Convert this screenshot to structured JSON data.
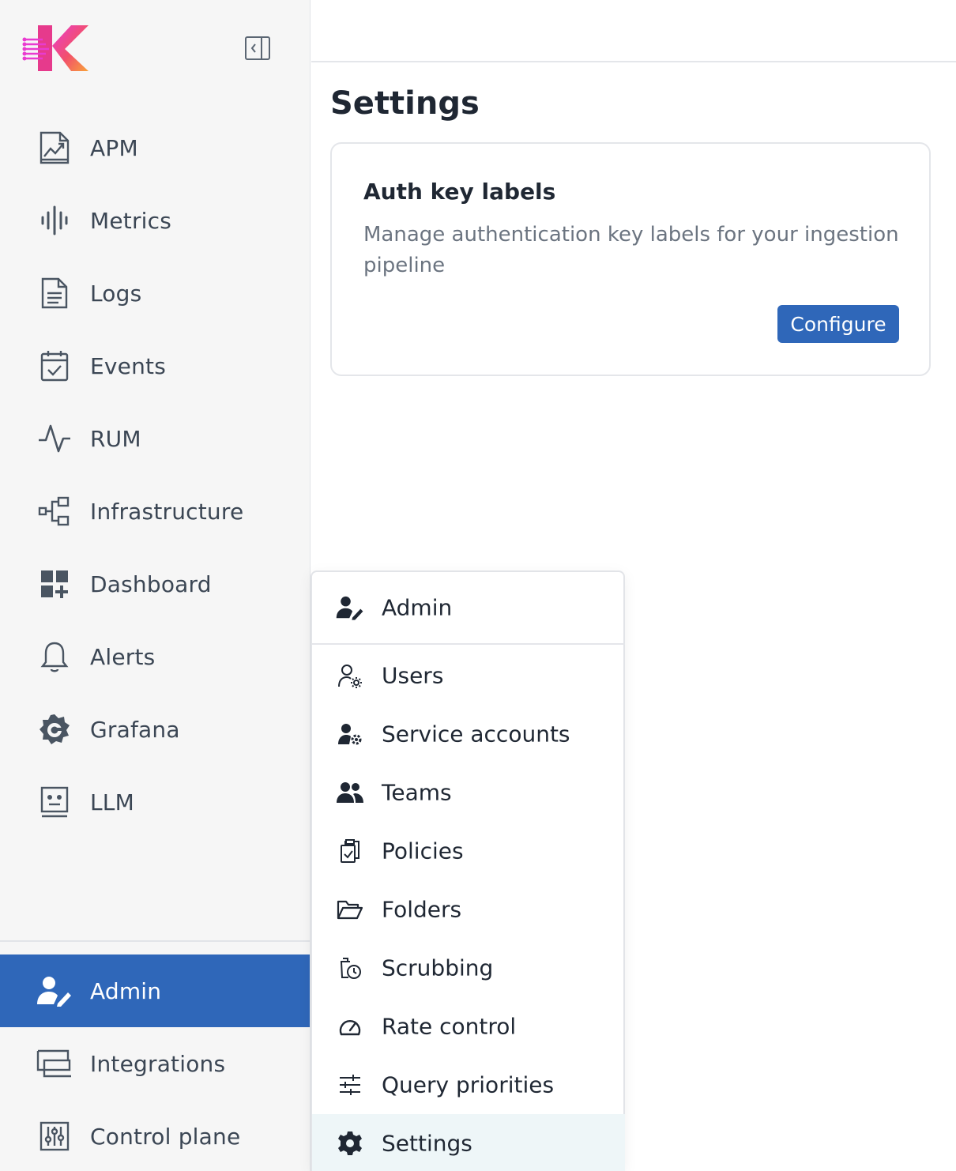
{
  "sidebar": {
    "logo_icon": "k-logo",
    "collapse_icon": "collapse-sidebar-icon",
    "items": [
      {
        "label": "APM",
        "icon": "apm-icon"
      },
      {
        "label": "Metrics",
        "icon": "metrics-icon"
      },
      {
        "label": "Logs",
        "icon": "logs-icon"
      },
      {
        "label": "Events",
        "icon": "events-icon"
      },
      {
        "label": "RUM",
        "icon": "rum-icon"
      },
      {
        "label": "Infrastructure",
        "icon": "infrastructure-icon"
      },
      {
        "label": "Dashboard",
        "icon": "dashboard-icon"
      },
      {
        "label": "Alerts",
        "icon": "bell-icon"
      },
      {
        "label": "Grafana",
        "icon": "grafana-icon"
      },
      {
        "label": "LLM",
        "icon": "llm-icon"
      }
    ],
    "bottom_items": [
      {
        "label": "Admin",
        "icon": "admin-icon",
        "active": true
      },
      {
        "label": "Integrations",
        "icon": "integrations-icon"
      },
      {
        "label": "Control plane",
        "icon": "control-plane-icon"
      }
    ]
  },
  "main": {
    "title": "Settings",
    "card": {
      "title": "Auth key labels",
      "description": "Manage authentication key labels for your ingestion pipeline",
      "button_label": "Configure"
    }
  },
  "admin_menu": {
    "header": {
      "label": "Admin",
      "icon": "admin-icon"
    },
    "items": [
      {
        "label": "Users",
        "icon": "user-gear-icon"
      },
      {
        "label": "Service accounts",
        "icon": "service-account-icon"
      },
      {
        "label": "Teams",
        "icon": "teams-icon"
      },
      {
        "label": "Policies",
        "icon": "policies-icon"
      },
      {
        "label": "Folders",
        "icon": "folder-open-icon"
      },
      {
        "label": "Scrubbing",
        "icon": "scrubbing-icon"
      },
      {
        "label": "Rate control",
        "icon": "gauge-icon"
      },
      {
        "label": "Query priorities",
        "icon": "sliders-icon"
      },
      {
        "label": "Settings",
        "icon": "gear-icon",
        "selected": true
      }
    ]
  },
  "colors": {
    "accent": "#2f67b9",
    "sidebar_bg": "#f6f6f6",
    "selected_menu_bg": "#eef6f8"
  }
}
